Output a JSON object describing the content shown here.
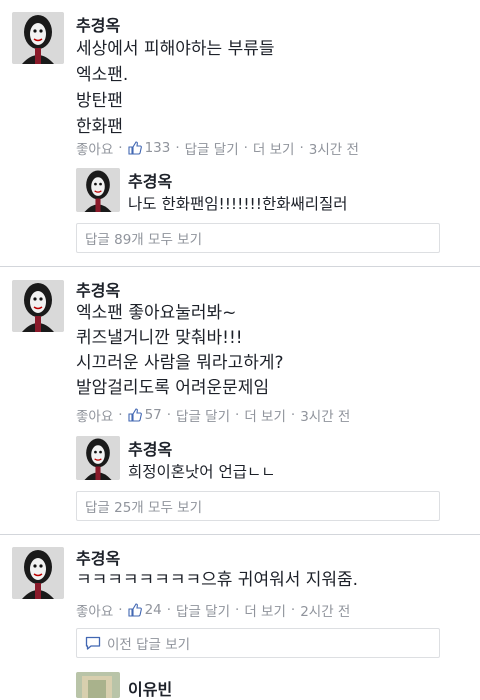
{
  "common": {
    "like": "좋아요",
    "reply": "답글 달기",
    "more": "더 보기",
    "sep": "·"
  },
  "comments": [
    {
      "author": "추경옥",
      "lines": [
        "세상에서 피해야하는 부류들",
        "엑소팬.",
        "방탄팬",
        "한화팬"
      ],
      "likes": "133",
      "time": "3시간 전",
      "reply": {
        "author": "추경옥",
        "text": "나도 한화팬임!!!!!!!한화쌔리질러"
      },
      "view_replies": "답글 89개 모두 보기"
    },
    {
      "author": "추경옥",
      "lines": [
        "엑소팬 좋아요눌러봐~",
        "퀴즈낼거니깐 맞춰바!!!",
        "시끄러운 사람을 뭐라고하게?",
        "발암걸리도록 어려운문제임"
      ],
      "likes": "57",
      "time": "3시간 전",
      "reply": {
        "author": "추경옥",
        "text": "희정이혼낫어 언급ㄴㄴ"
      },
      "view_replies": "답글 25개 모두 보기"
    },
    {
      "author": "추경옥",
      "lines": [
        "ㅋㅋㅋㅋㅋㅋㅋㅋ으휴 귀여워서 지워줌."
      ],
      "likes": "24",
      "time": "2시간 전",
      "prev_replies": "이전 답글 보기",
      "reply": {
        "author": "이유빈"
      }
    }
  ]
}
